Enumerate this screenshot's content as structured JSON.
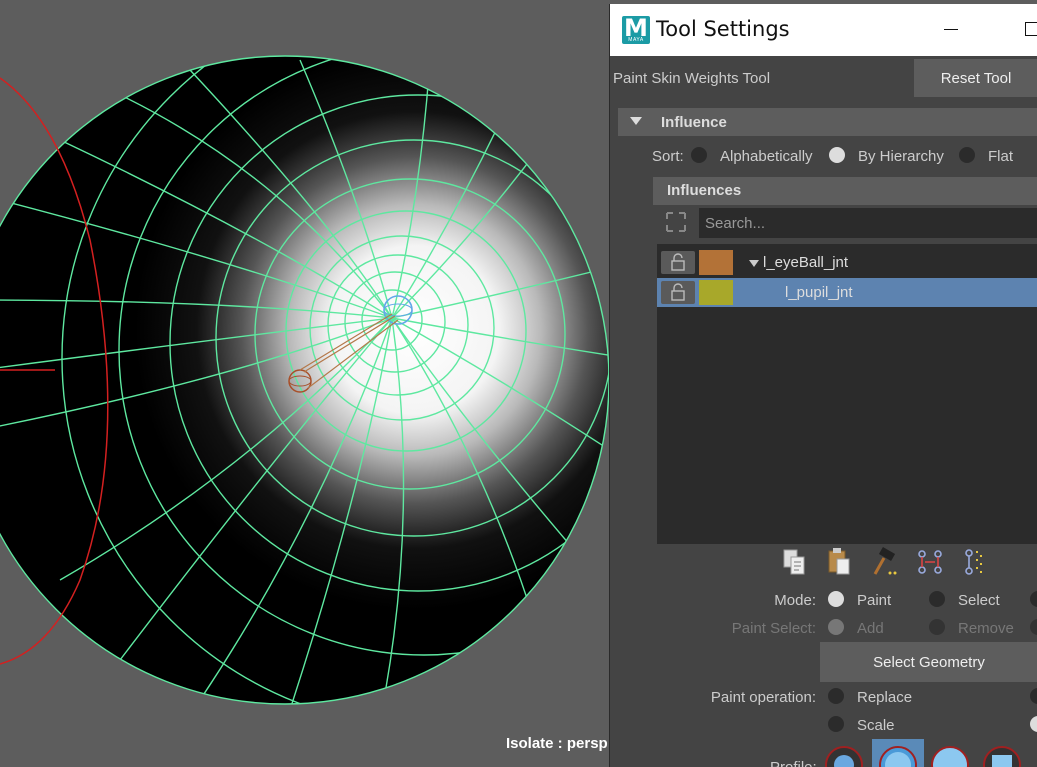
{
  "viewport": {
    "label": "Isolate : persp"
  },
  "window": {
    "title": "Tool Settings",
    "logo": {
      "letter": "M",
      "sub": "MAYA"
    }
  },
  "tool": {
    "name": "Paint Skin Weights Tool",
    "reset_label": "Reset Tool"
  },
  "influence_section": {
    "header": "Influence",
    "sort": {
      "label": "Sort:",
      "options": [
        "Alphabetically",
        "By Hierarchy",
        "Flat"
      ],
      "selected": "By Hierarchy"
    },
    "influences_header": "Influences",
    "search": {
      "placeholder": "Search..."
    },
    "joints": [
      {
        "name": "l_eyeBall_jnt",
        "color": "#b37237",
        "selected": false
      },
      {
        "name": "l_pupil_jnt",
        "color": "#a8a82a",
        "selected": true
      }
    ]
  },
  "tool_icons": [
    "copy-weights-icon",
    "paste-weights-icon",
    "weight-hammer-icon",
    "move-weights-icon",
    "show-influences-icon"
  ],
  "mode": {
    "label": "Mode:",
    "options": [
      "Paint",
      "Select"
    ],
    "selected": "Paint"
  },
  "paint_select": {
    "label": "Paint Select:",
    "options": [
      "Add",
      "Remove"
    ],
    "enabled": false
  },
  "select_geometry_label": "Select Geometry",
  "paint_operation": {
    "label": "Paint operation:",
    "options": [
      "Replace",
      "Scale"
    ],
    "selected": "Replace"
  },
  "profile": {
    "label": "Profile:"
  },
  "colors": {
    "accent_select": "#5d83b0",
    "wireframe": "#5ee8a0",
    "curve": "#d42020"
  }
}
